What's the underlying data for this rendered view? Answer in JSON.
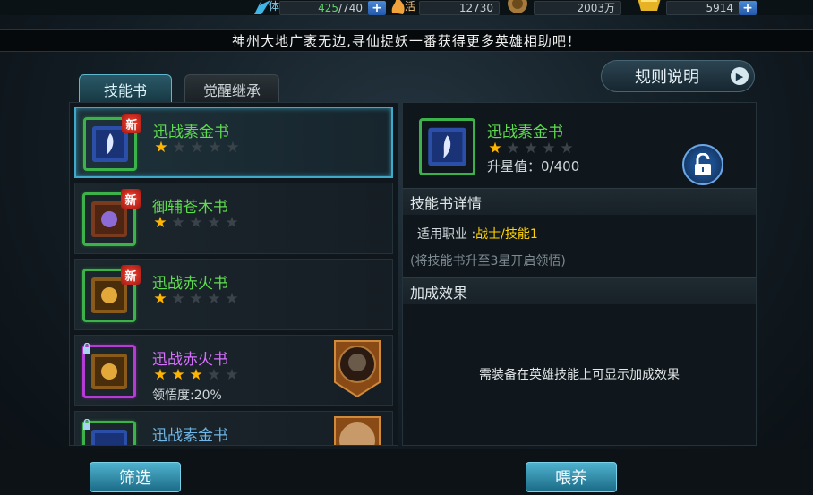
{
  "resources": {
    "stamina": {
      "label": "体",
      "current": "425",
      "max": "740"
    },
    "power": {
      "label": "活",
      "value": "12730"
    },
    "coins": {
      "value": "2003万"
    },
    "gold": {
      "value": "5914"
    },
    "plus": "+"
  },
  "marquee_text": "神州大地广袤无边,寻仙捉妖一番获得更多英雄相助吧！",
  "tabs": [
    {
      "label": "技能书",
      "active": true
    },
    {
      "label": "觉醒继承",
      "active": false
    }
  ],
  "rules_button": "规则说明",
  "new_badge": "新",
  "book_list": [
    {
      "name": "迅战素金书",
      "stars": 1,
      "max_stars": 5,
      "quality": "green",
      "new": true,
      "art": "blue-book"
    },
    {
      "name": "御辅苍木书",
      "stars": 1,
      "max_stars": 5,
      "quality": "green",
      "new": true,
      "art": "green-book"
    },
    {
      "name": "迅战赤火书",
      "stars": 1,
      "max_stars": 5,
      "quality": "green",
      "new": true,
      "art": "gold-book"
    },
    {
      "name": "迅战赤火书",
      "stars": 3,
      "max_stars": 5,
      "quality": "purple",
      "new": false,
      "locked": true,
      "comprehension": "领悟度:20%",
      "art": "gold-book"
    },
    {
      "name": "迅战素金书",
      "stars": 0,
      "max_stars": 5,
      "quality": "green",
      "new": false,
      "locked": true,
      "art": "blue-book"
    }
  ],
  "detail": {
    "name": "迅战素金书",
    "stars": 1,
    "max_stars": 5,
    "star_value_label": "升星值：",
    "star_value": "0/400",
    "details_header": "技能书详情",
    "job_label": "适用职业  :",
    "job_value": "战士/技能1",
    "hint": "(将技能书升至3星开启领悟)",
    "bonus_header": "加成效果",
    "bonus_empty": "需装备在英雄技能上可显示加成效果"
  },
  "buttons": {
    "filter": "筛选",
    "feed": "喂养"
  },
  "colors": {
    "green_quality": "#5fdc4f",
    "purple_quality": "#d86fff",
    "star_on": "#ffb400",
    "accent": "#3fa9c9",
    "job_value": "#ffd200"
  }
}
